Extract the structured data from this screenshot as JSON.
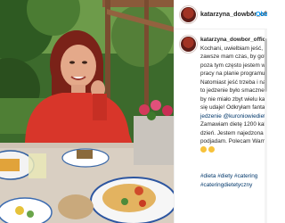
{
  "header": {
    "username": "katarzyna_dowbor_offi",
    "separator": "•",
    "follow_label": "Obse"
  },
  "post": {
    "username": "katarzyna_dowbor_official",
    "caption_lines": [
      "Kochani, uwielbiam jeść, ale",
      "zawsze mam czas, by gotowa",
      "poza tym często jestem w tra",
      "pracy na planie programu.",
      "Natomiast jeść trzeba i najle",
      "to jedzenie było smaczne, zd",
      "by nie miało zbyt wielu kalor",
      "się udaje! Odkryłam fanta",
      "jedzenie @kuroniowiediety",
      "Zamawiam dietę 1200 kalori",
      "dzień. Jestem najedzona i ni",
      "podjadam. Polecam Wam ich"
    ],
    "hashtags": [
      "#dieta #diety #catering",
      "#cateringdietetyczny"
    ]
  },
  "colors": {
    "accent": "#0095f6",
    "mention": "#00376b",
    "text": "#262626"
  }
}
